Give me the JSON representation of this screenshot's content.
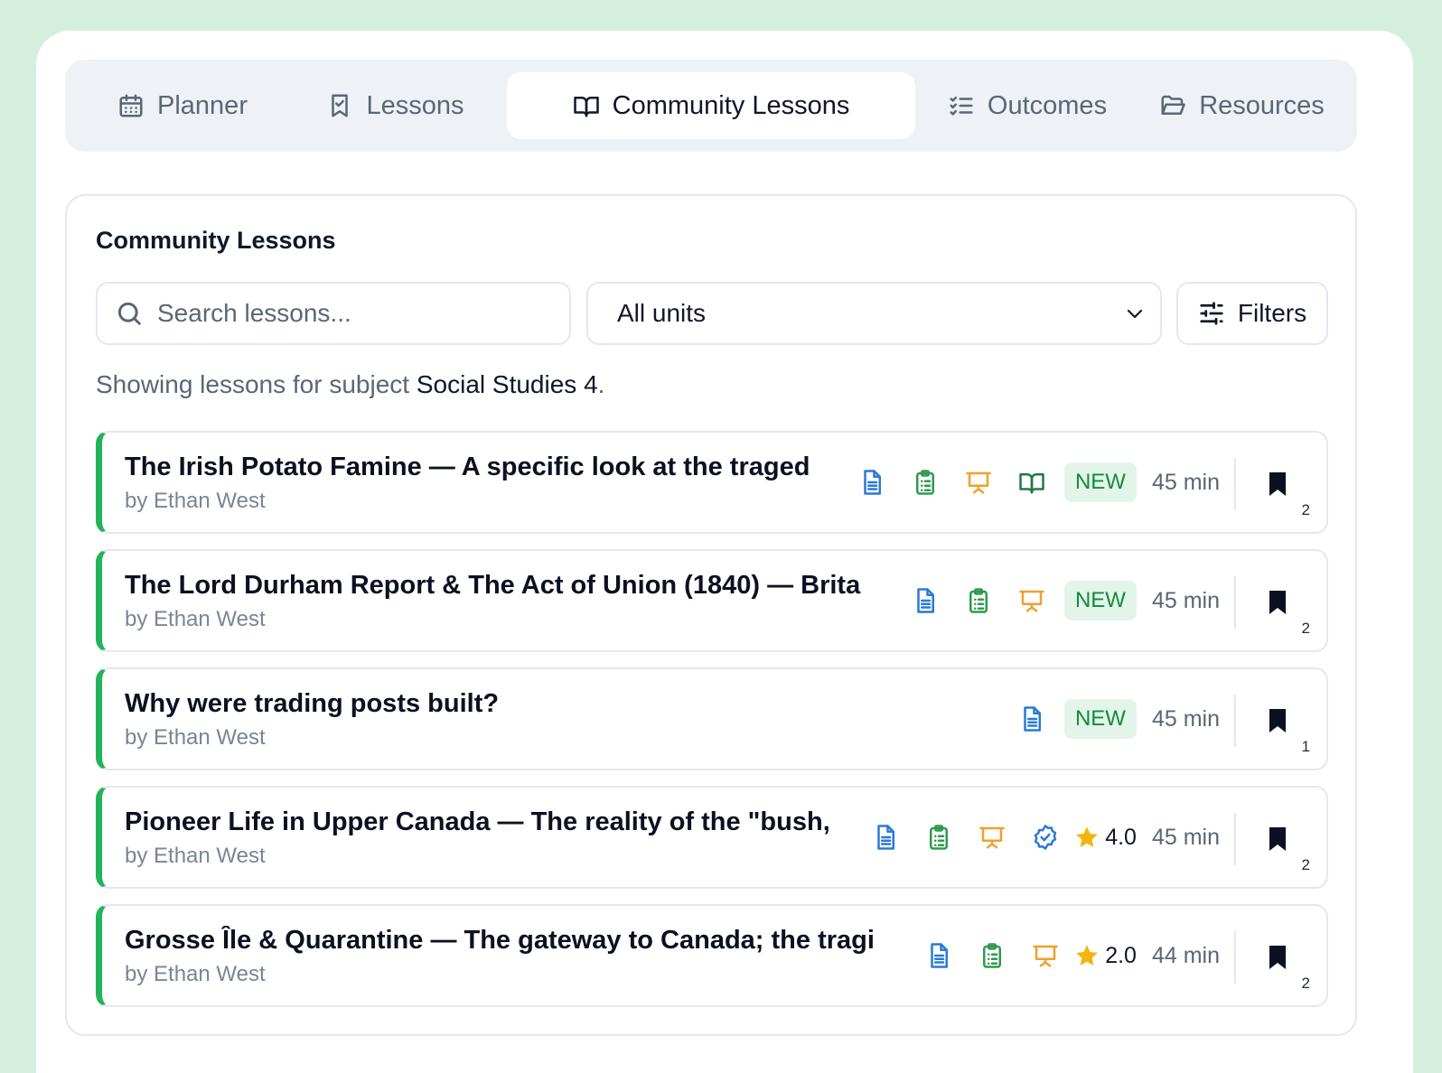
{
  "tabs": [
    {
      "label": "Planner",
      "icon": "calendar-icon",
      "active": false
    },
    {
      "label": "Lessons",
      "icon": "bookmark-check-icon",
      "active": false
    },
    {
      "label": "Community Lessons",
      "icon": "open-book-icon",
      "active": true
    },
    {
      "label": "Outcomes",
      "icon": "checklist-icon",
      "active": false
    },
    {
      "label": "Resources",
      "icon": "folder-icon",
      "active": false
    }
  ],
  "card": {
    "title": "Community Lessons",
    "search_placeholder": "Search lessons...",
    "unit_select": "All units",
    "filters_label": "Filters",
    "showing_prefix": "Showing lessons for subject",
    "subject": "Social Studies 4",
    "showing_suffix": "."
  },
  "colors": {
    "accent": "#22b45a",
    "doc": "#2979d8",
    "worksheet": "#2e9a4e",
    "presentation": "#f0a030",
    "star": "#f5b40b"
  },
  "lessons": [
    {
      "title": "The Irish Potato Famine — A specific look at the traged",
      "author": "by Ethan West",
      "resources": [
        "document-icon",
        "clipboard-icon",
        "presentation-icon",
        "open-book-icon"
      ],
      "new": "NEW",
      "rating": null,
      "duration": "45 min",
      "bookmarks": "2"
    },
    {
      "title": "The Lord Durham Report & The Act of Union (1840) — Brita",
      "author": "by Ethan West",
      "resources": [
        "document-icon",
        "clipboard-icon",
        "presentation-icon"
      ],
      "new": "NEW",
      "rating": null,
      "duration": "45 min",
      "bookmarks": "2"
    },
    {
      "title": "Why were trading posts built?",
      "author": "by Ethan West",
      "resources": [
        "document-icon"
      ],
      "new": "NEW",
      "rating": null,
      "duration": "45 min",
      "bookmarks": "1"
    },
    {
      "title": "Pioneer Life in Upper Canada — The reality of the \"bush,",
      "author": "by Ethan West",
      "resources": [
        "document-icon",
        "clipboard-icon",
        "presentation-icon",
        "verified-badge-icon"
      ],
      "new": null,
      "rating": "4.0",
      "duration": "45 min",
      "bookmarks": "2"
    },
    {
      "title": "Grosse Île & Quarantine — The gateway to Canada; the tragi",
      "author": "by Ethan West",
      "resources": [
        "document-icon",
        "clipboard-icon",
        "presentation-icon"
      ],
      "new": null,
      "rating": "2.0",
      "duration": "44 min",
      "bookmarks": "2"
    }
  ]
}
